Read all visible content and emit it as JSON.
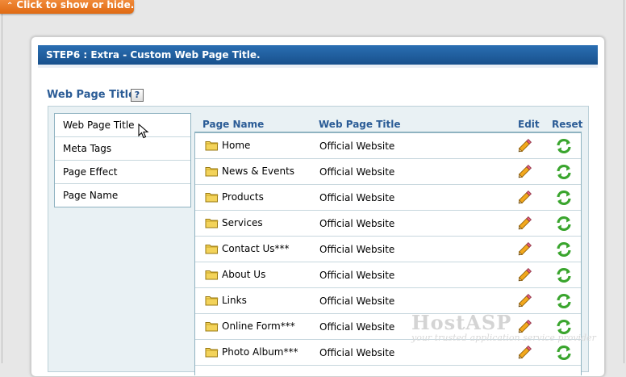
{
  "toggle": {
    "label": "Click to show or hide."
  },
  "step": {
    "title": "STEP6 : Extra - Custom Web Page Title."
  },
  "section": {
    "title": "Web Page Title",
    "help_label": "?"
  },
  "sidebar": {
    "items": [
      {
        "label": "Web Page Title"
      },
      {
        "label": "Meta Tags"
      },
      {
        "label": "Page Effect"
      },
      {
        "label": "Page Name"
      }
    ]
  },
  "table": {
    "headers": {
      "page_name": "Page Name",
      "web_page_title": "Web Page Title",
      "edit": "Edit",
      "reset": "Reset"
    },
    "rows": [
      {
        "name": "Home",
        "title": "Official Website"
      },
      {
        "name": "News & Events",
        "title": "Official Website"
      },
      {
        "name": "Products",
        "title": "Official Website"
      },
      {
        "name": "Services",
        "title": "Official Website"
      },
      {
        "name": "Contact Us***",
        "title": "Official Website"
      },
      {
        "name": "About Us",
        "title": "Official Website"
      },
      {
        "name": "Links",
        "title": "Official Website"
      },
      {
        "name": "Online Form***",
        "title": "Official Website"
      },
      {
        "name": "Photo Album***",
        "title": "Official Website"
      }
    ]
  },
  "watermark": {
    "brand": "HostASP",
    "tagline": "your trusted application service provider"
  },
  "colors": {
    "header_blue": "#1f5f9f",
    "accent_orange": "#e8741f",
    "title_blue": "#2b5c96"
  }
}
